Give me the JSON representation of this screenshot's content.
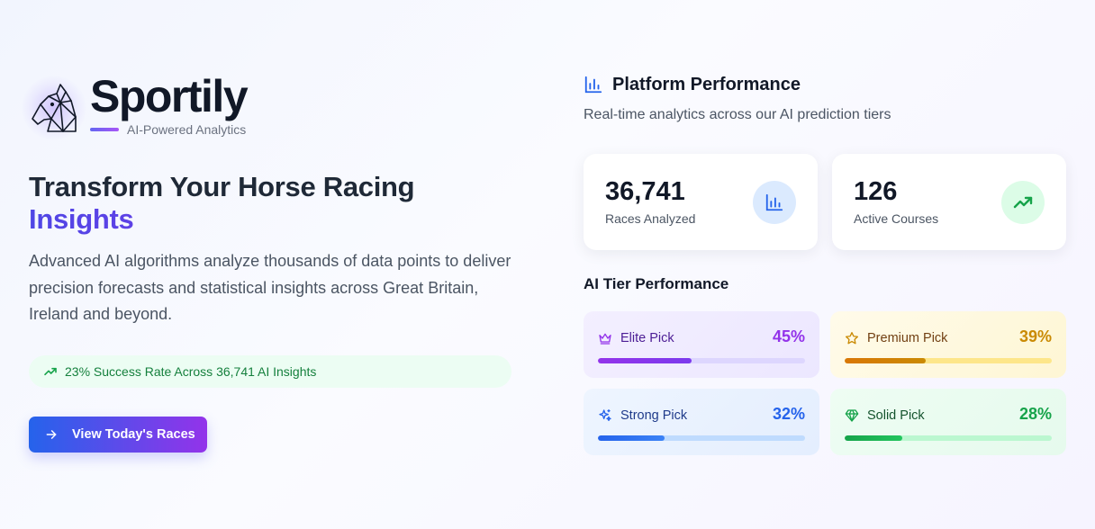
{
  "brand": {
    "name": "Sportily",
    "tagline": "AI-Powered Analytics"
  },
  "hero": {
    "headline": "Transform Your Horse Racing",
    "headline_accent": "Insights",
    "description": "Advanced AI algorithms analyze thousands of data points to deliver precision forecasts and statistical insights across Great Britain, Ireland and beyond.",
    "success_text": "23% Success Rate Across 36,741 AI Insights",
    "cta_label": "View Today's Races"
  },
  "performance": {
    "title": "Platform Performance",
    "subtitle": "Real-time analytics across our AI prediction tiers",
    "stats": [
      {
        "value": "36,741",
        "label": "Races Analyzed",
        "icon": "bar-chart-icon",
        "color": "#2563eb"
      },
      {
        "value": "126",
        "label": "Active Courses",
        "icon": "trending-up-icon",
        "color": "#16a34a"
      }
    ],
    "tier_title": "AI Tier Performance",
    "tiers": [
      {
        "name": "Elite Pick",
        "pct": "45%",
        "value": 45,
        "icon": "crown-icon",
        "color": "#9333ea"
      },
      {
        "name": "Premium Pick",
        "pct": "39%",
        "value": 39,
        "icon": "star-icon",
        "color": "#ca8a04"
      },
      {
        "name": "Strong Pick",
        "pct": "32%",
        "value": 32,
        "icon": "sparkles-icon",
        "color": "#2563eb"
      },
      {
        "name": "Solid Pick",
        "pct": "28%",
        "value": 28,
        "icon": "gem-icon",
        "color": "#16a34a"
      }
    ]
  }
}
